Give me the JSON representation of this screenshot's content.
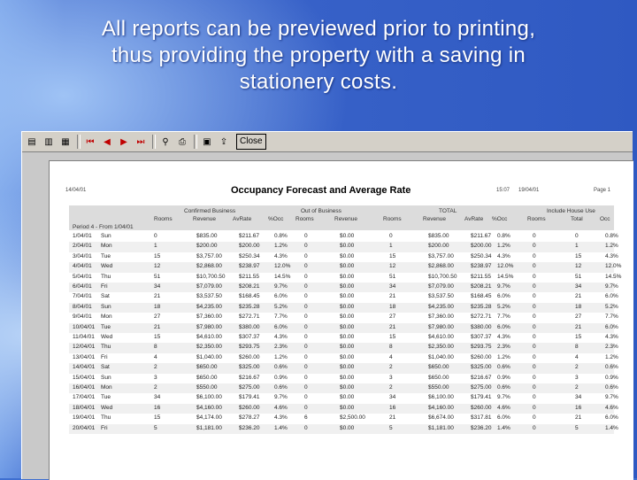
{
  "slide": {
    "title_line1": "All reports can be previewed prior to printing,",
    "title_line2": "thus providing the property with a saving in",
    "title_line3": "stationery costs."
  },
  "toolbar": {
    "close_label": "Close",
    "icons": [
      "page-icon",
      "two-page-icon",
      "zoom-icon",
      "first-page-icon",
      "prev-page-icon",
      "next-page-icon",
      "last-page-icon",
      "binoculars-icon",
      "print-icon",
      "save-icon",
      "export-icon"
    ]
  },
  "report": {
    "title": "Occupancy Forecast and Average Rate",
    "date": "14/04/01",
    "printed": "15:07",
    "printed_date": "19/04/01",
    "page_label": "Page 1",
    "group_headers": [
      "Confirmed Business",
      "Out of Business",
      "TOTAL",
      "Include House Use"
    ],
    "columns": [
      "Rooms",
      "Revenue",
      "AvRate",
      "%Occ",
      "Rooms",
      "Revenue",
      "Rooms",
      "Revenue",
      "AvRate",
      "%Occ",
      "Rooms",
      "Total",
      "Occ"
    ],
    "period_label": "Period 4 - From 1/04/01",
    "rows": [
      [
        "1/04/01",
        "Sun",
        "0",
        "$835.00",
        "$211.67",
        "0.8%",
        "0",
        "$0.00",
        "0",
        "$835.00",
        "$211.67",
        "0.8%",
        "0",
        "0",
        "0.8%"
      ],
      [
        "2/04/01",
        "Mon",
        "1",
        "$200.00",
        "$200.00",
        "1.2%",
        "0",
        "$0.00",
        "1",
        "$200.00",
        "$200.00",
        "1.2%",
        "0",
        "1",
        "1.2%"
      ],
      [
        "3/04/01",
        "Tue",
        "15",
        "$3,757.00",
        "$250.34",
        "4.3%",
        "0",
        "$0.00",
        "15",
        "$3,757.00",
        "$250.34",
        "4.3%",
        "0",
        "15",
        "4.3%"
      ],
      [
        "4/04/01",
        "Wed",
        "12",
        "$2,868.00",
        "$238.97",
        "12.0%",
        "0",
        "$0.00",
        "12",
        "$2,868.00",
        "$238.97",
        "12.0%",
        "0",
        "12",
        "12.0%"
      ],
      [
        "5/04/01",
        "Thu",
        "51",
        "$10,700.50",
        "$211.55",
        "14.5%",
        "0",
        "$0.00",
        "51",
        "$10,700.50",
        "$211.55",
        "14.5%",
        "0",
        "51",
        "14.5%"
      ],
      [
        "6/04/01",
        "Fri",
        "34",
        "$7,079.00",
        "$208.21",
        "9.7%",
        "0",
        "$0.00",
        "34",
        "$7,079.00",
        "$208.21",
        "9.7%",
        "0",
        "34",
        "9.7%"
      ],
      [
        "7/04/01",
        "Sat",
        "21",
        "$3,537.50",
        "$168.45",
        "6.0%",
        "0",
        "$0.00",
        "21",
        "$3,537.50",
        "$168.45",
        "6.0%",
        "0",
        "21",
        "6.0%"
      ],
      [
        "8/04/01",
        "Sun",
        "18",
        "$4,235.00",
        "$235.28",
        "5.2%",
        "0",
        "$0.00",
        "18",
        "$4,235.00",
        "$235.28",
        "5.2%",
        "0",
        "18",
        "5.2%"
      ],
      [
        "9/04/01",
        "Mon",
        "27",
        "$7,360.00",
        "$272.71",
        "7.7%",
        "0",
        "$0.00",
        "27",
        "$7,360.00",
        "$272.71",
        "7.7%",
        "0",
        "27",
        "7.7%"
      ],
      [
        "10/04/01",
        "Tue",
        "21",
        "$7,980.00",
        "$380.00",
        "6.0%",
        "0",
        "$0.00",
        "21",
        "$7,980.00",
        "$380.00",
        "6.0%",
        "0",
        "21",
        "6.0%"
      ],
      [
        "11/04/01",
        "Wed",
        "15",
        "$4,610.00",
        "$307.37",
        "4.3%",
        "0",
        "$0.00",
        "15",
        "$4,610.00",
        "$307.37",
        "4.3%",
        "0",
        "15",
        "4.3%"
      ],
      [
        "12/04/01",
        "Thu",
        "8",
        "$2,350.00",
        "$293.75",
        "2.3%",
        "0",
        "$0.00",
        "8",
        "$2,350.00",
        "$293.75",
        "2.3%",
        "0",
        "8",
        "2.3%"
      ],
      [
        "13/04/01",
        "Fri",
        "4",
        "$1,040.00",
        "$260.00",
        "1.2%",
        "0",
        "$0.00",
        "4",
        "$1,040.00",
        "$260.00",
        "1.2%",
        "0",
        "4",
        "1.2%"
      ],
      [
        "14/04/01",
        "Sat",
        "2",
        "$650.00",
        "$325.00",
        "0.6%",
        "0",
        "$0.00",
        "2",
        "$650.00",
        "$325.00",
        "0.6%",
        "0",
        "2",
        "0.6%"
      ],
      [
        "15/04/01",
        "Sun",
        "3",
        "$650.00",
        "$216.67",
        "0.9%",
        "0",
        "$0.00",
        "3",
        "$650.00",
        "$216.67",
        "0.9%",
        "0",
        "3",
        "0.9%"
      ],
      [
        "16/04/01",
        "Mon",
        "2",
        "$550.00",
        "$275.00",
        "0.6%",
        "0",
        "$0.00",
        "2",
        "$550.00",
        "$275.00",
        "0.6%",
        "0",
        "2",
        "0.6%"
      ],
      [
        "17/04/01",
        "Tue",
        "34",
        "$6,100.00",
        "$179.41",
        "9.7%",
        "0",
        "$0.00",
        "34",
        "$6,100.00",
        "$179.41",
        "9.7%",
        "0",
        "34",
        "9.7%"
      ],
      [
        "18/04/01",
        "Wed",
        "16",
        "$4,160.00",
        "$260.00",
        "4.6%",
        "0",
        "$0.00",
        "16",
        "$4,160.00",
        "$260.00",
        "4.6%",
        "0",
        "16",
        "4.6%"
      ],
      [
        "19/04/01",
        "Thu",
        "15",
        "$4,174.00",
        "$278.27",
        "4.3%",
        "6",
        "$2,500.00",
        "21",
        "$6,674.00",
        "$317.81",
        "6.0%",
        "0",
        "21",
        "6.0%"
      ],
      [
        "20/04/01",
        "Fri",
        "5",
        "$1,181.00",
        "$236.20",
        "1.4%",
        "0",
        "$0.00",
        "5",
        "$1,181.00",
        "$236.20",
        "1.4%",
        "0",
        "5",
        "1.4%"
      ]
    ]
  }
}
